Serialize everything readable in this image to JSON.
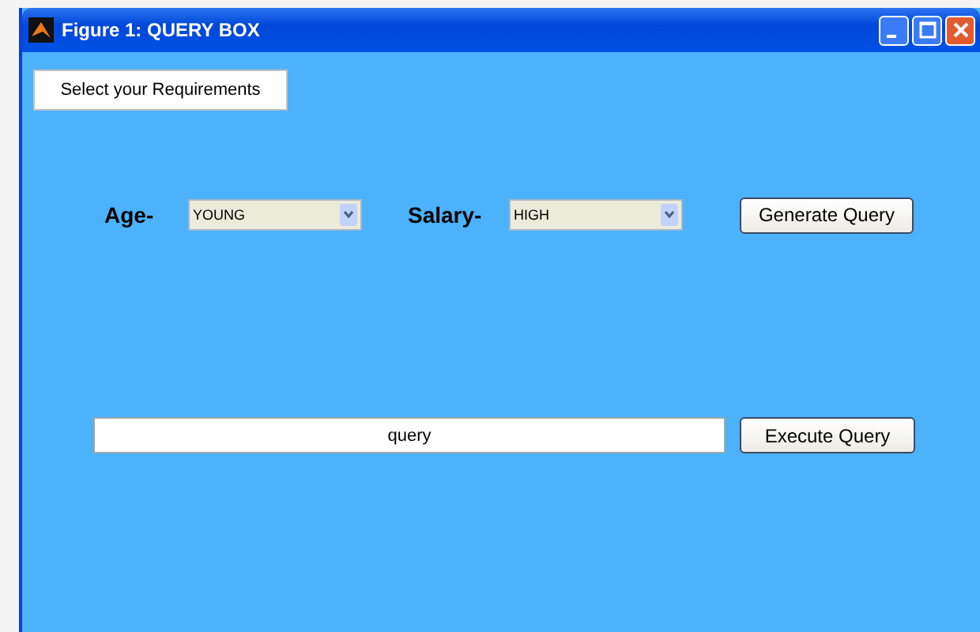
{
  "window": {
    "title": "Figure 1: QUERY BOX"
  },
  "heading": "Select your Requirements",
  "filters": [
    {
      "label": "Age-",
      "value": "YOUNG"
    },
    {
      "label": "Salary-",
      "value": "HIGH"
    }
  ],
  "generate_button": "Generate Query",
  "query_field": {
    "value": "query"
  },
  "execute_button": "Execute Query"
}
